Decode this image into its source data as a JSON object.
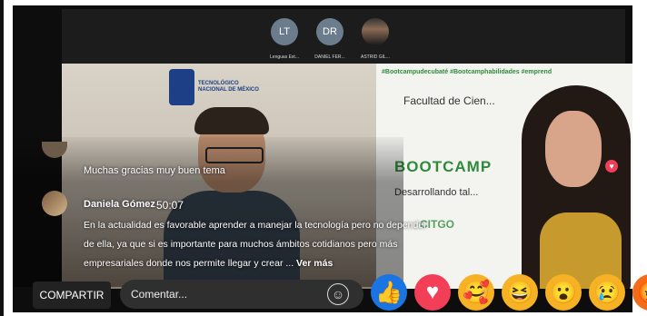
{
  "participants": [
    {
      "initials": "LT",
      "name": "Lenguas Ext..."
    },
    {
      "initials": "DR",
      "name": "DANIEL FER..."
    },
    {
      "initials": "",
      "name": "ASTRID GIL..."
    }
  ],
  "left_tile": {
    "logo_line1": "TECNOLÓGICO",
    "logo_line2": "NACIONAL DE MÉXICO"
  },
  "right_tile": {
    "hashtags": "#Bootcampudecubaté #Bootcamphabilidades #emprend",
    "slide_title": "Facultad de Cien...",
    "bootcamp": "BOOTCAMP",
    "subtitle": "Desarrollando tal...",
    "sponsor": "CITGO"
  },
  "comments": [
    {
      "text": "Muchas gracias muy buen tema"
    },
    {
      "author": "Daniela Gómez",
      "time": "50:07",
      "text": "En la actualidad es favorable aprender a manejar la tecnología pero no depender de ella, ya que si es importante para muchos ámbitos cotidianos pero más empresariales donde nos permite llegar y crear ...",
      "more_label": "Ver más"
    }
  ],
  "bottom_bar": {
    "share_label": "COMPARTIR",
    "comment_placeholder": "Comentar..."
  },
  "reactions": [
    {
      "name": "like-reaction",
      "glyph": "👍"
    },
    {
      "name": "love-reaction",
      "glyph": "♥"
    },
    {
      "name": "care-reaction",
      "glyph": "🥰"
    },
    {
      "name": "haha-reaction",
      "glyph": "😆"
    },
    {
      "name": "wow-reaction",
      "glyph": "😮"
    },
    {
      "name": "sad-reaction",
      "glyph": "😢"
    },
    {
      "name": "angry-reaction",
      "glyph": "😡"
    }
  ],
  "colors": {
    "like": "#1b74e4",
    "love": "#f33e58",
    "accent_green": "#2f8b3b",
    "brand_blue": "#1c3f86"
  }
}
